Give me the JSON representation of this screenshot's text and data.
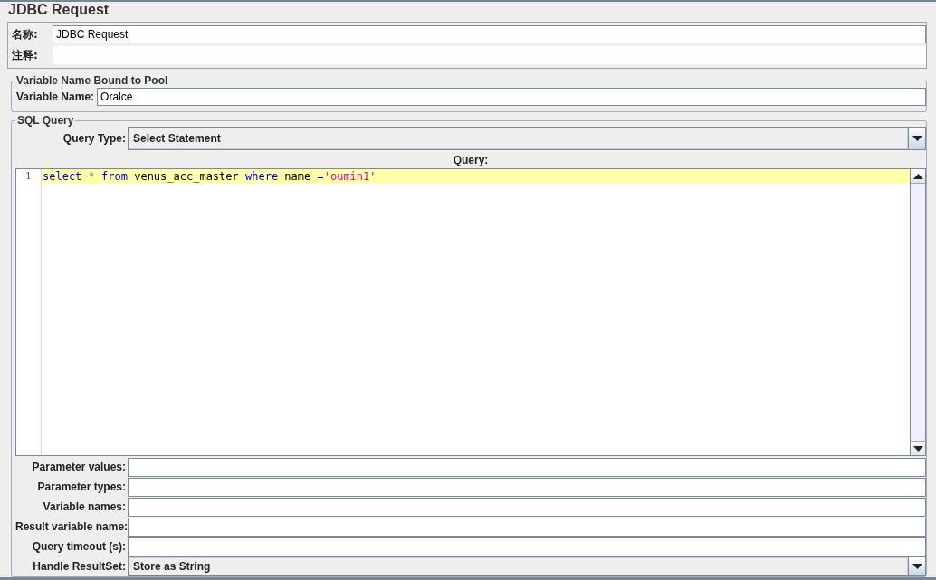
{
  "title": "JDBC Request",
  "name_row": {
    "label": "名称:",
    "value": "JDBC Request"
  },
  "comment_row": {
    "label": "注释:"
  },
  "pool": {
    "legend": "Variable Name Bound to Pool",
    "label": "Variable Name:",
    "value": "Oralce"
  },
  "sql": {
    "legend": "SQL Query",
    "query_type": {
      "label": "Query Type:",
      "value": "Select Statement"
    },
    "query_label": "Query:",
    "lines": [
      {
        "number": "1",
        "tokens": [
          {
            "kind": "keyword",
            "text": "select"
          },
          {
            "kind": "operator",
            "text": " * "
          },
          {
            "kind": "keyword",
            "text": "from"
          },
          {
            "kind": "plain",
            "text": " venus_acc_master "
          },
          {
            "kind": "keyword",
            "text": "where"
          },
          {
            "kind": "plain",
            "text": " name ="
          },
          {
            "kind": "string",
            "text": "'oumin1'"
          }
        ]
      }
    ],
    "fields": [
      {
        "kind": "text",
        "label": "Parameter values:"
      },
      {
        "kind": "text",
        "label": "Parameter types:"
      },
      {
        "kind": "text",
        "label": "Variable names:"
      },
      {
        "kind": "text",
        "label": "Result variable name:"
      },
      {
        "kind": "text",
        "label": "Query timeout (s):"
      },
      {
        "kind": "select",
        "label": "Handle ResultSet:",
        "value": "Store as String"
      }
    ]
  }
}
